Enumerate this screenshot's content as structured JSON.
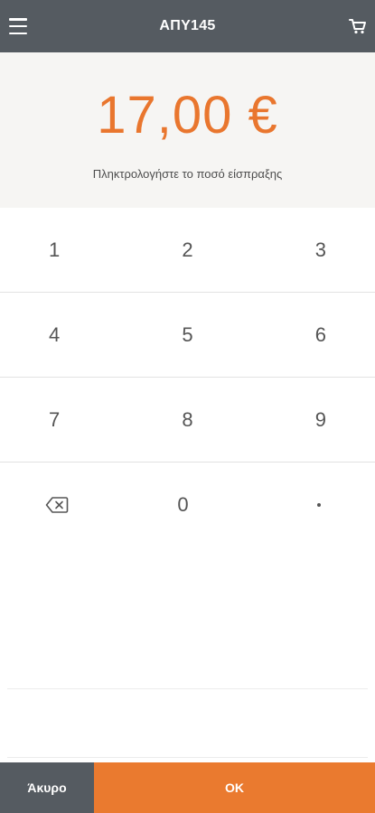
{
  "header": {
    "title": "ΑΠΥ145",
    "menu_icon": "hamburger-menu-icon",
    "cart_icon": "shopping-cart-icon",
    "background": "#555b61"
  },
  "amount_panel": {
    "amount": "17,00 €",
    "hint": "Πληκτρολογήστε το ποσό είσπραξης",
    "amount_color": "#e9762e"
  },
  "keypad": {
    "rows": [
      [
        "1",
        "2",
        "3"
      ],
      [
        "4",
        "5",
        "6"
      ],
      [
        "7",
        "8",
        "9"
      ]
    ],
    "backspace_icon": "backspace-icon",
    "zero": "0",
    "decimal_icon": "decimal-point-icon"
  },
  "footer": {
    "cancel_label": "Άκυρο",
    "ok_label": "OK",
    "cancel_color": "#555b61",
    "ok_color": "#ea7a2f"
  }
}
